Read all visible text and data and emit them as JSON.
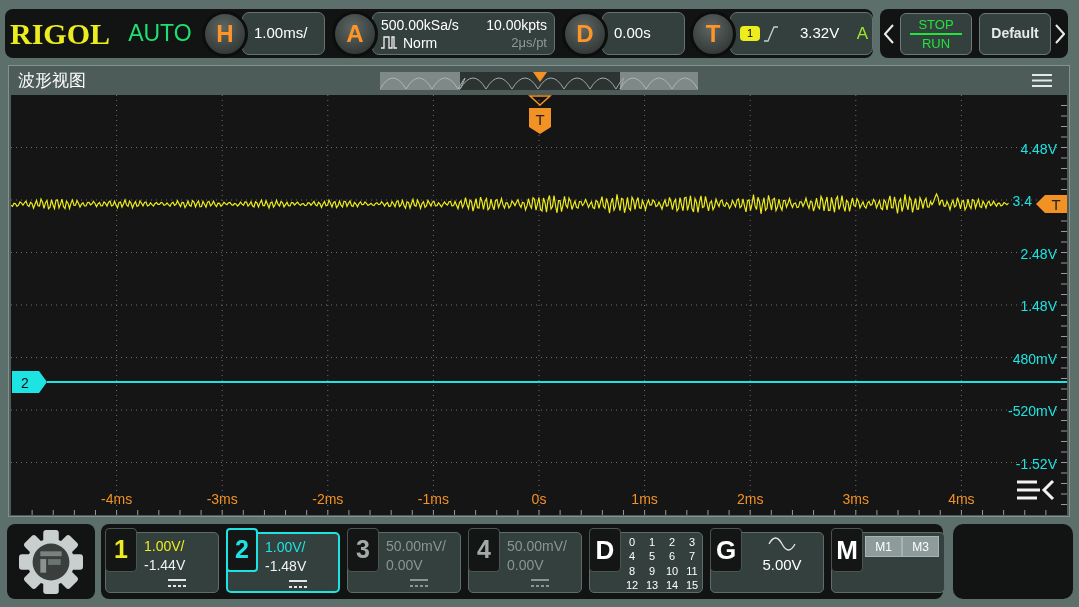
{
  "top_bar": {
    "brand": "RIGOL",
    "trigger_status": "AUTO",
    "horizontal": {
      "key": "H",
      "scale": "1.00ms/"
    },
    "acquisition": {
      "key": "A",
      "sample_rate": "500.00kSa/s",
      "memory_depth": "10.00kpts",
      "mode": "Norm",
      "time_per_point": "2μs/pt"
    },
    "delay": {
      "key": "D",
      "offset": "0.00s"
    },
    "trigger": {
      "key": "T",
      "source": "1",
      "level": "3.32V",
      "sweep": "A"
    },
    "run_stop": {
      "stop": "STOP",
      "run": "RUN"
    },
    "default_button": "Default"
  },
  "waveform_view": {
    "title": "波形视图",
    "trigger_position_marker": "T",
    "trigger_level_marker": "T",
    "channel_marker": "2",
    "voltage_labels": [
      {
        "text": "4.48V",
        "kind": "full"
      },
      {
        "text": "3.4",
        "kind": "cut"
      },
      {
        "text": "2.48V",
        "kind": "full"
      },
      {
        "text": "1.48V",
        "kind": "full"
      },
      {
        "text": "480mV",
        "kind": "full"
      },
      {
        "text": "-520mV",
        "kind": "full"
      },
      {
        "text": "-1.52V",
        "kind": "full"
      }
    ],
    "time_labels": [
      "-4ms",
      "-3ms",
      "-2ms",
      "-1ms",
      "0s",
      "1ms",
      "2ms",
      "3ms",
      "4ms"
    ]
  },
  "channels": [
    {
      "number": "1",
      "scale": "1.00V/",
      "offset": "-1.44V",
      "on": true,
      "selected": false,
      "color": "#ecec1e"
    },
    {
      "number": "2",
      "scale": "1.00V/",
      "offset": "-1.48V",
      "on": true,
      "selected": true,
      "color": "#1ee3e3"
    },
    {
      "number": "3",
      "scale": "50.00mV/",
      "offset": "0.00V",
      "on": false,
      "selected": false
    },
    {
      "number": "4",
      "scale": "50.00mV/",
      "offset": "0.00V",
      "on": false,
      "selected": false
    }
  ],
  "digital": {
    "key": "D",
    "bits": [
      "0",
      "1",
      "2",
      "3",
      "4",
      "5",
      "6",
      "7",
      "8",
      "9",
      "10",
      "11",
      "12",
      "13",
      "14",
      "15"
    ]
  },
  "generator": {
    "key": "G",
    "amplitude": "5.00V"
  },
  "math": {
    "key": "M",
    "slots": [
      "M1",
      "M3"
    ]
  }
}
